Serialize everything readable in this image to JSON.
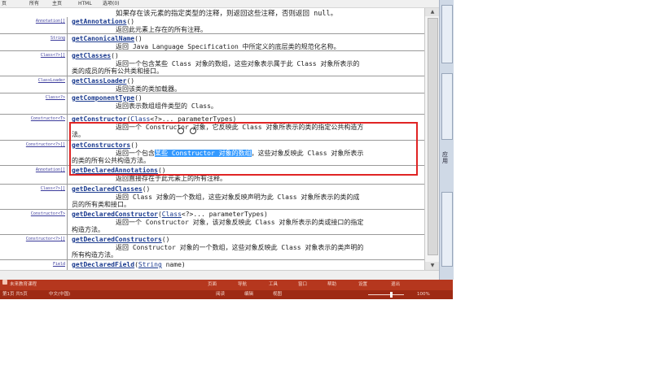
{
  "menu": {
    "items": [
      "页",
      "所有",
      "主页",
      "HTML",
      "选项(0)"
    ]
  },
  "intro_line": "如果存在该元素的指定类型的注释，则返回这些注释，否则返回 null。",
  "methods": [
    {
      "mod": "Annotation[]",
      "name": "getAnnotations",
      "params": "()",
      "desc": "返回此元素上存在的所有注释。",
      "cont": ""
    },
    {
      "mod": "String",
      "name": "getCanonicalName",
      "params": "()",
      "desc": "返回 Java Language Specification 中所定义的底层类的规范化名称。",
      "cont": ""
    },
    {
      "mod": "Class<?>[]",
      "name": "getClasses",
      "params": "()",
      "desc": "返回一个包含某些 Class 对象的数组，这些对象表示属于此 Class 对象所表示的",
      "cont": "类的成员的所有公共类和接口。"
    },
    {
      "mod": "ClassLoader",
      "name": "getClassLoader",
      "params": "()",
      "desc": "返回该类的类加载器。",
      "cont": ""
    },
    {
      "mod": "Class<?>",
      "name": "getComponentType",
      "params": "()",
      "desc": "返回表示数组组件类型的 Class。",
      "cont": ""
    },
    {
      "mod": "Constructor<T>",
      "name": "getConstructor",
      "params_pre": "(",
      "ptype": "Class",
      "params_post": "<?>... parameterTypes)",
      "desc": "返回一个 Constructor 对象，它反映此 Class 对象所表示的类的指定公共构造方",
      "cont": "法。"
    },
    {
      "mod": "Constructor<?>[]",
      "name": "getConstructors",
      "params": "()",
      "desc_pre": "返回一个包含",
      "desc_hl": "某些 Constructor 对象的数组",
      "desc_post": "，这些对象反映此 Class 对象所表示",
      "cont": "的类的所有公共构造方法。"
    },
    {
      "mod": "Annotation[]",
      "name": "getDeclaredAnnotations",
      "params": "()",
      "desc": "返回直接存在于此元素上的所有注释。",
      "cont": ""
    },
    {
      "mod": "Class<?>[]",
      "name": "getDeclaredClasses",
      "params": "()",
      "desc": "返回 Class 对象的一个数组，这些对象反映声明为此 Class 对象所表示的类的成",
      "cont": "员的所有类和接口。"
    },
    {
      "mod": "Constructor<T>",
      "name": "getDeclaredConstructor",
      "params_pre": "(",
      "ptype": "Class",
      "params_post": "<?>... parameterTypes)",
      "desc": "返回一个 Constructor 对象，该对象反映此 Class 对象所表示的类或接口的指定",
      "cont": "构造方法。"
    },
    {
      "mod": "Constructor<?>[]",
      "name": "getDeclaredConstructors",
      "params": "()",
      "desc": "返回 Constructor 对象的一个数组，这些对象反映此 Class 对象表示的类声明的",
      "cont": "所有构造方法。"
    },
    {
      "mod": "Field",
      "name": "getDeclaredField",
      "params_pre": "(",
      "ptype": "String",
      "params_post": " name)",
      "desc": "",
      "cont": ""
    }
  ],
  "right_panel_text": "应用",
  "orange_bar": {
    "left": "未来教育课程",
    "items": [
      "页面",
      "导航",
      "工具",
      "窗口",
      "帮助",
      "设置",
      "退出"
    ]
  },
  "dark_bar": {
    "left": "第1页 共5页",
    "mid": "中文(中国)",
    "items": [
      "阅读",
      "编辑",
      "视图"
    ],
    "zoom": "100%"
  }
}
